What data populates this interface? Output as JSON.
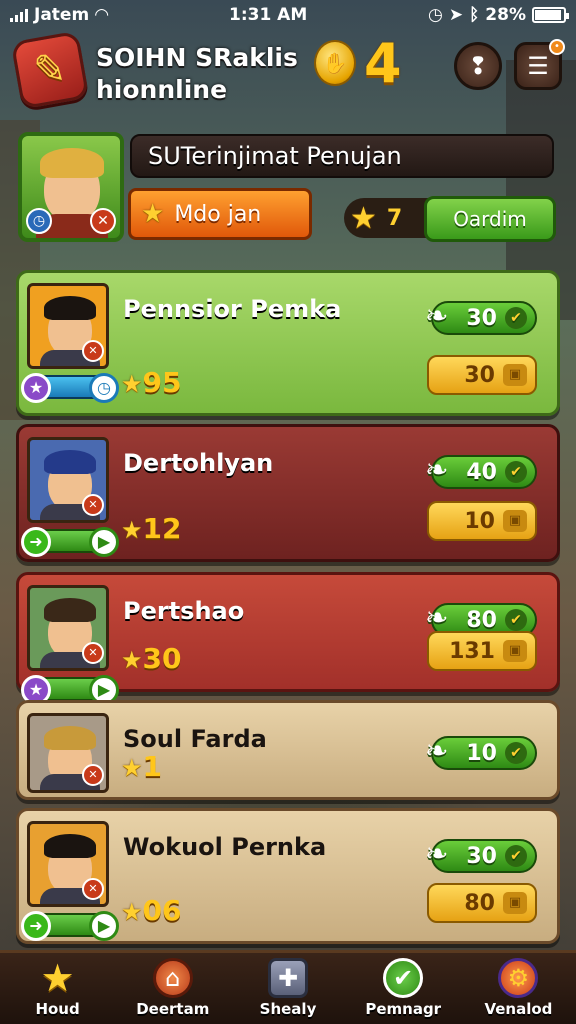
{
  "status_bar": {
    "carrier": "Jatem",
    "time": "1:31 AM",
    "battery": "28%"
  },
  "header": {
    "title_line1": "SOIHN SRaklis",
    "title_line2": "hionnline",
    "coin_value": "4",
    "logo_icon": "sword-icon",
    "buttons": [
      {
        "name": "alert-button",
        "icon": "exclamation-icon"
      },
      {
        "name": "menu-button",
        "icon": "hamburger-icon"
      }
    ]
  },
  "player": {
    "name": "SUTerinjimat Penujan",
    "mode_label": "Mdo jan",
    "stars": "7",
    "action_label": "Oardim"
  },
  "rows": [
    {
      "name": "Pennsior Pemka",
      "rating": "95",
      "green_value": "30",
      "gold_value": "30",
      "bg": "green",
      "bar": "blue",
      "bar_badge": "gear-icon",
      "hair": "#1a1410",
      "avatar_bg": "#f0a020"
    },
    {
      "name": "Dertohlyan",
      "rating": "12",
      "green_value": "40",
      "gold_value": "10",
      "bg": "maroon",
      "bar": "green",
      "bar_badge": "play-icon",
      "hair": "#243a8a",
      "avatar_bg": "#4a6ab0"
    },
    {
      "name": "Pertshao",
      "rating": "30",
      "green_value": "80",
      "gold_value": "131",
      "bg": "red",
      "bar": "green",
      "bar_badge": "",
      "hair": "#3a2818",
      "avatar_bg": "#6a9a5a"
    },
    {
      "name": "Soul Farda",
      "rating": "1",
      "green_value": "10",
      "gold_value": "",
      "bg": "tan",
      "bar": "none",
      "bar_badge": "",
      "hair": "#c89a3a",
      "avatar_bg": "#a89a88"
    },
    {
      "name": "Wokuol Pernka",
      "rating": "06",
      "green_value": "30",
      "gold_value": "80",
      "bg": "tan",
      "bar": "green",
      "bar_badge": "play-icon",
      "hair": "#1a1410",
      "avatar_bg": "#e8a030"
    }
  ],
  "nav": [
    {
      "label": "Houd",
      "icon": "star-icon"
    },
    {
      "label": "Deertam",
      "icon": "house-icon"
    },
    {
      "label": "Shealy",
      "icon": "plus-icon"
    },
    {
      "label": "Pemnagr",
      "icon": "check-icon"
    },
    {
      "label": "Venalod",
      "icon": "gear-icon"
    }
  ],
  "colors": {
    "gold": "#ffc61a",
    "green": "#3a9a1a",
    "orange": "#e0580a",
    "bar_bg": "#1e120c"
  }
}
